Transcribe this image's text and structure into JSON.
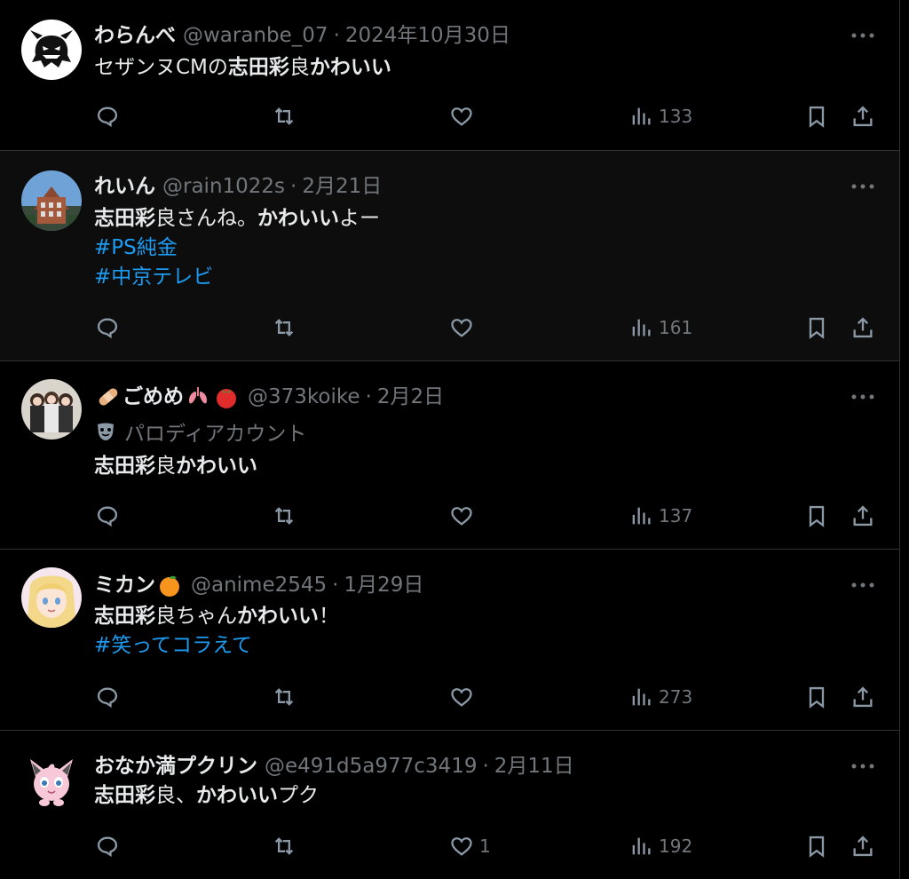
{
  "tweets": [
    {
      "name": "わらんべ",
      "handle": "@waranbe_07",
      "date": "2024年10月30日",
      "body_lines": [
        [
          {
            "t": "セザンヌCMの",
            "s": "n"
          },
          {
            "t": "志田彩",
            "s": "b"
          },
          {
            "t": "良",
            "s": "n"
          },
          {
            "t": "かわいい",
            "s": "b"
          }
        ]
      ],
      "likes": "",
      "views": "133"
    },
    {
      "name": "れいん",
      "handle": "@rain1022s",
      "date": "2月21日",
      "body_lines": [
        [
          {
            "t": "志田彩",
            "s": "b"
          },
          {
            "t": "良さんね。",
            "s": "n"
          },
          {
            "t": "かわいい",
            "s": "b"
          },
          {
            "t": "よー",
            "s": "n"
          }
        ],
        [
          {
            "t": "#PS純金",
            "s": "tag"
          }
        ],
        [
          {
            "t": "#中京テレビ",
            "s": "tag"
          }
        ]
      ],
      "likes": "",
      "views": "161"
    },
    {
      "name": "ごめめ",
      "handle": "@373koike",
      "date": "2月2日",
      "parody_label": "パロディアカウント",
      "body_lines": [
        [
          {
            "t": "志田彩",
            "s": "b"
          },
          {
            "t": "良",
            "s": "n"
          },
          {
            "t": "かわいい",
            "s": "b"
          }
        ]
      ],
      "likes": "",
      "views": "137"
    },
    {
      "name": "ミカン",
      "handle": "@anime2545",
      "date": "1月29日",
      "body_lines": [
        [
          {
            "t": "志田彩",
            "s": "b"
          },
          {
            "t": "良ちゃん",
            "s": "n"
          },
          {
            "t": "かわいい",
            "s": "b"
          },
          {
            "t": "！",
            "s": "n"
          }
        ],
        [
          {
            "t": "#笑ってコラえて",
            "s": "tag"
          }
        ]
      ],
      "likes": "",
      "views": "273"
    },
    {
      "name": "おなか満プクリン",
      "handle": "@e491d5a977c3419",
      "date": "2月11日",
      "body_lines": [
        [
          {
            "t": "志田彩",
            "s": "b"
          },
          {
            "t": "良、",
            "s": "n"
          },
          {
            "t": "かわいい",
            "s": "b"
          },
          {
            "t": "プク",
            "s": "n"
          }
        ]
      ],
      "likes": "1",
      "views": "192"
    }
  ],
  "colors": {
    "background": "#000000",
    "highlight_background": "#0d0d0d",
    "text": "#e7e9ea",
    "muted": "#71767b",
    "link": "#1d9bf0",
    "divider": "#2f3336"
  },
  "icons": {
    "more": "more-dots-icon",
    "reply": "reply-icon",
    "retweet": "retweet-icon",
    "like": "heart-icon",
    "views": "views-chart-icon",
    "bookmark": "bookmark-icon",
    "share": "share-icon",
    "parody": "mask-icon"
  }
}
